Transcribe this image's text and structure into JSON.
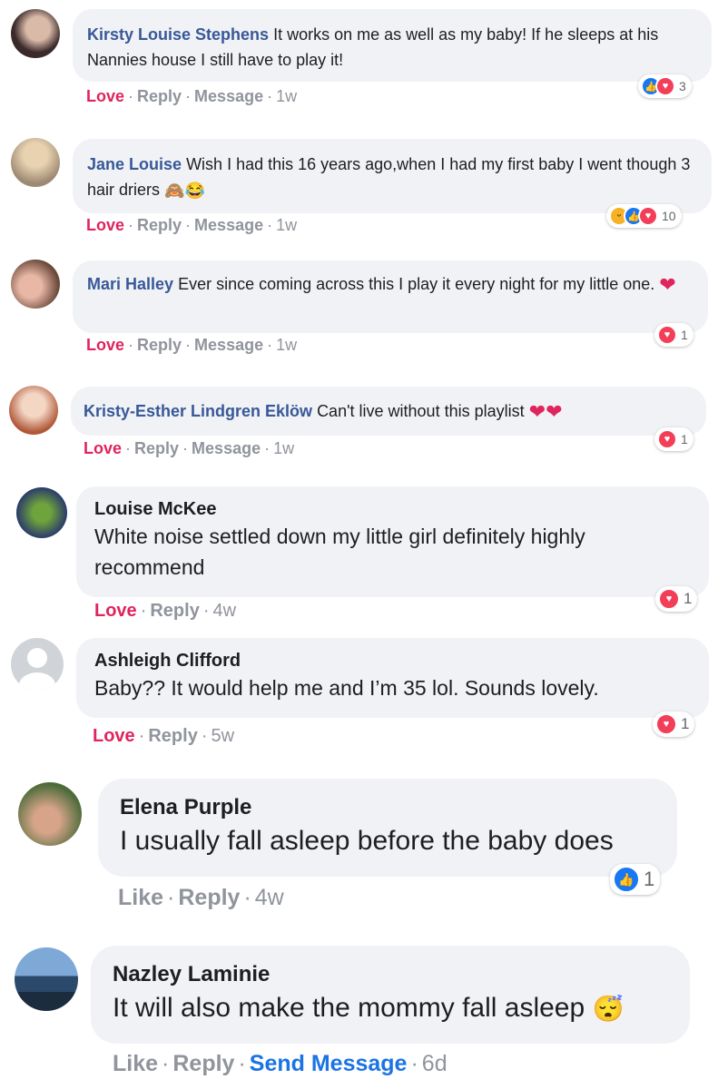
{
  "comments": [
    {
      "name": "Kirsty Louise Stephens",
      "text": "It works on me as well as my baby! If he sleeps at his Nannies house I still have to play it!",
      "actions": [
        "Love",
        "Reply",
        "Message"
      ],
      "time": "1w",
      "reactions": [
        "like",
        "love"
      ],
      "reaction_count": "3"
    },
    {
      "name": "Jane Louise",
      "text": "Wish I had this 16 years ago,when I had my first baby I went though 3 hair driers",
      "emojis": [
        "see-no-evil-monkey-emoji",
        "tears-of-joy-emoji"
      ],
      "actions": [
        "Love",
        "Reply",
        "Message"
      ],
      "time": "1w",
      "reactions": [
        "haha",
        "like",
        "love"
      ],
      "reaction_count": "10"
    },
    {
      "name": "Mari Halley",
      "text": "Ever since coming across this I play it every night for my little one.",
      "emojis": [
        "red-heart-emoji"
      ],
      "actions": [
        "Love",
        "Reply",
        "Message"
      ],
      "time": "1w",
      "reactions": [
        "love"
      ],
      "reaction_count": "1"
    },
    {
      "name": "Kristy-Esther Lindgren Eklöw",
      "text": "Can't live without this playlist",
      "emojis": [
        "red-heart-emoji",
        "red-heart-emoji"
      ],
      "actions": [
        "Love",
        "Reply",
        "Message"
      ],
      "time": "1w",
      "reactions": [
        "love"
      ],
      "reaction_count": "1"
    },
    {
      "name": "Louise McKee",
      "text": "White noise settled down my little girl definitely highly recommend",
      "actions": [
        "Love",
        "Reply"
      ],
      "time": "4w",
      "reactions": [
        "love"
      ],
      "reaction_count": "1"
    },
    {
      "name": "Ashleigh Clifford",
      "text": "Baby?? It would help me and I’m 35 lol. Sounds lovely.",
      "actions": [
        "Love",
        "Reply"
      ],
      "time": "5w",
      "reactions": [
        "love"
      ],
      "reaction_count": "1"
    },
    {
      "name": "Elena Purple",
      "text": "I usually fall asleep before the baby does",
      "actions": [
        "Like",
        "Reply"
      ],
      "time": "4w",
      "reactions": [
        "like"
      ],
      "reaction_count": "1"
    },
    {
      "name": "Nazley Laminie",
      "text": "It will also make the mommy fall asleep",
      "emojis": [
        "sleeping-face-emoji"
      ],
      "actions": [
        "Like",
        "Reply",
        "Send Message"
      ],
      "time": "6d"
    }
  ],
  "colors": {
    "name_link": "#385898",
    "love": "#e0245e",
    "send_message": "#1b74e4",
    "bubble": "#f0f2f5",
    "meta": "#90949c"
  }
}
